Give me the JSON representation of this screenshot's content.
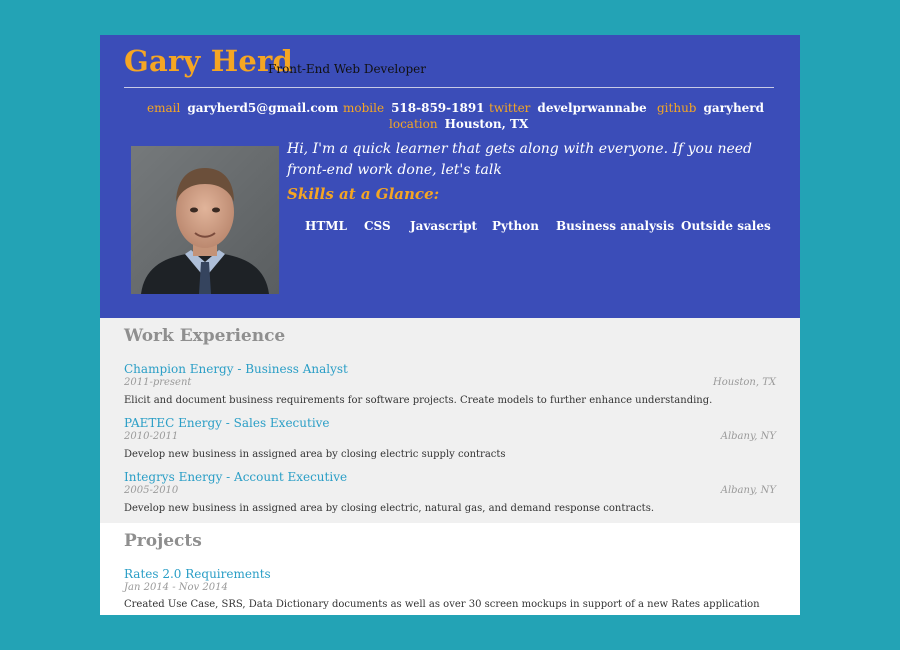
{
  "profile": {
    "name": "Gary Herd",
    "role": "Front-End Web Developer"
  },
  "contacts": [
    {
      "label": "email",
      "value": "garyherd5@gmail.com"
    },
    {
      "label": "mobile",
      "value": "518-859-1891"
    },
    {
      "label": "twitter",
      "value": "develprwannabe"
    },
    {
      "label": "github",
      "value": "garyherd"
    },
    {
      "label": "location",
      "value": "Houston, TX"
    }
  ],
  "bio": "Hi, I'm a quick learner that gets along with everyone. If you need front-end work done, let's talk",
  "skills": {
    "title": "Skills at a Glance:",
    "items": [
      "HTML",
      "CSS",
      "Javascript",
      "Python",
      "Business analysis",
      "Outside sales"
    ]
  },
  "work": {
    "title": "Work Experience",
    "jobs": [
      {
        "title": "Champion Energy - Business Analyst",
        "dates": "2011-present",
        "location": "Houston, TX",
        "description": "Elicit and document business requirements for software projects. Create models to further enhance understanding."
      },
      {
        "title": "PAETEC Energy - Sales Executive",
        "dates": "2010-2011",
        "location": "Albany, NY",
        "description": "Develop new business in assigned area by closing electric supply contracts"
      },
      {
        "title": "Integrys Energy - Account Executive",
        "dates": "2005-2010",
        "location": "Albany, NY",
        "description": "Develop new business in assigned area by closing electric, natural gas, and demand response contracts."
      }
    ]
  },
  "projects": {
    "title": "Projects",
    "items": [
      {
        "title": "Rates 2.0 Requirements",
        "dates": "Jan 2014 - Nov 2014",
        "description": "Created Use Case, SRS, Data Dictionary documents as well as over 30 screen mockups in support of a new Rates application"
      }
    ]
  },
  "colors": {
    "page_background": "#23a3b5",
    "header_background": "#3b4db8",
    "accent": "#f5a623",
    "link": "#2a9ec6"
  }
}
